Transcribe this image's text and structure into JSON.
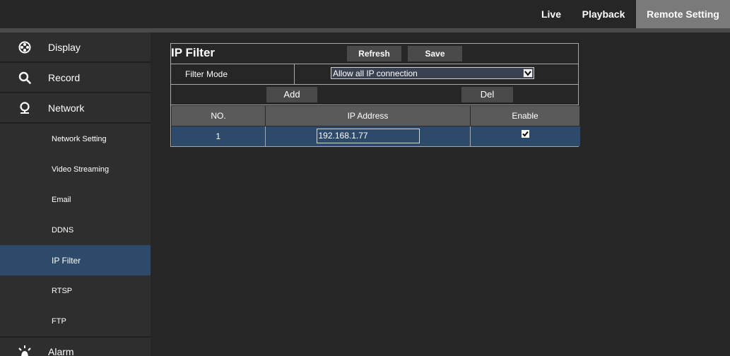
{
  "topnav": {
    "live": "Live",
    "playback": "Playback",
    "remote_setting": "Remote Setting"
  },
  "sidebar": {
    "main": [
      {
        "label": "Display",
        "icon": "display-icon"
      },
      {
        "label": "Record",
        "icon": "search-icon"
      },
      {
        "label": "Network",
        "icon": "network-icon"
      }
    ],
    "network_items": [
      {
        "label": "Network Setting"
      },
      {
        "label": "Video Streaming"
      },
      {
        "label": "Email"
      },
      {
        "label": "DDNS"
      },
      {
        "label": "IP Filter",
        "active": true
      },
      {
        "label": "RTSP"
      },
      {
        "label": "FTP"
      }
    ],
    "alarm": {
      "label": "Alarm",
      "icon": "alarm-icon"
    }
  },
  "panel": {
    "title": "IP Filter",
    "refresh_label": "Refresh",
    "save_label": "Save",
    "filter_mode_label": "Filter Mode",
    "filter_mode_value": "Allow all IP connection",
    "add_label": "Add",
    "del_label": "Del",
    "columns": [
      "NO.",
      "IP Address",
      "Enable"
    ],
    "rows": [
      {
        "no": "1",
        "ip": "192.168.1.77",
        "enabled": true
      }
    ]
  },
  "colors": {
    "background": "#262626",
    "sidebar": "#2e2e2e",
    "active_item": "#2e4a6b",
    "active_tab": "#7a7a7a",
    "header_cell": "#5a5a5a"
  }
}
